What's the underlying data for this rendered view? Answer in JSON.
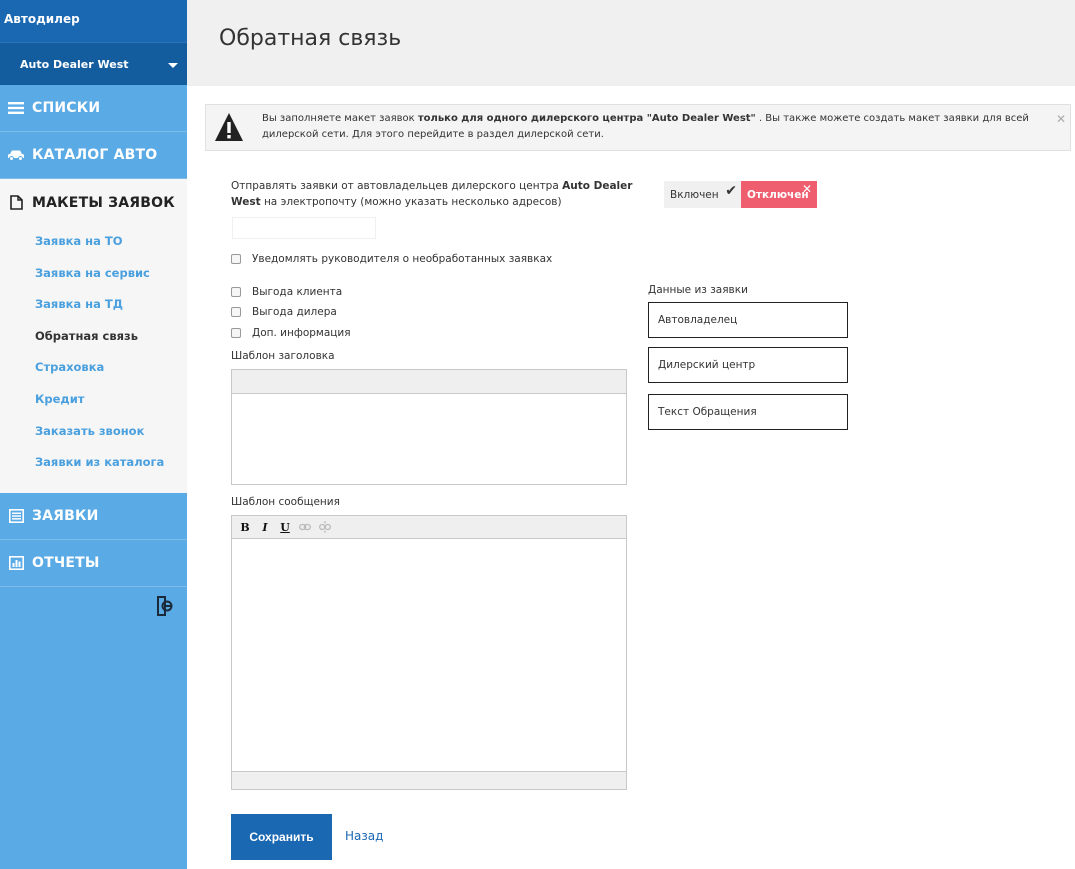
{
  "sidebar": {
    "brand": "Автодилер",
    "dealer": "Auto Dealer West",
    "nav": [
      {
        "label": "Списки",
        "icon": "list-icon"
      },
      {
        "label": "Каталог авто",
        "icon": "car-icon"
      },
      {
        "label": "Макеты заявок",
        "icon": "document-icon"
      }
    ],
    "submenu": [
      "Заявка на ТО",
      "Заявка на сервис",
      "Заявка на ТД",
      "Обратная связь",
      "Страховка",
      "Кредит",
      "Заказать звонок",
      "Заявки из каталога"
    ],
    "nav_bottom": [
      {
        "label": "Заявки",
        "icon": "form-icon"
      },
      {
        "label": "Отчеты",
        "icon": "chart-icon"
      }
    ]
  },
  "header": {
    "title": "Обратная связь"
  },
  "alert": {
    "text_before": "Вы заполняете макет заявок ",
    "text_bold": "только для одного дилерского центра \"Auto Dealer West\"",
    "text_after": " . Вы также можете создать макет заявки для всей дилерской сети. Для этого перейдите в раздел дилерской сети."
  },
  "email": {
    "label_before": "Отправлять заявки от автовладельцев дилерского центра ",
    "label_bold": "Auto Dealer West",
    "label_after": " на электропочту (можно указать несколько адресов)",
    "value": "",
    "placeholder": ""
  },
  "toggle": {
    "on_label": "Включен",
    "off_label": "Отключен"
  },
  "notify_manager": "Уведомлять руководителя о необработанных заявках",
  "options": [
    "Выгода клиента",
    "Выгода дилера",
    "Доп. информация"
  ],
  "title_template_label": "Шаблон заголовка",
  "message_template_label": "Шаблон сообщения",
  "data_fields_label": "Данные из заявки",
  "data_fields": [
    "Автовладелец",
    "Дилерский центр",
    "Текст Обращения"
  ],
  "toolbar": {
    "bold": "B",
    "italic": "I",
    "underline": "U"
  },
  "actions": {
    "save": "Сохранить",
    "back": "Назад"
  },
  "colors": {
    "sidebar": "#5aaae6",
    "brand": "#1a67b2",
    "primary_button": "#1a67b2",
    "toggle_off": "#ee5e6e"
  }
}
